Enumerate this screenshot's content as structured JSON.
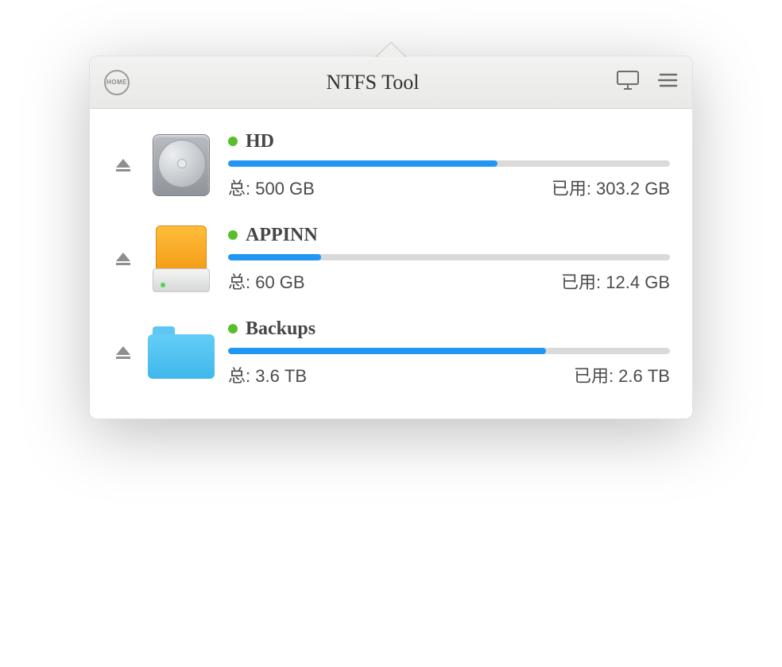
{
  "header": {
    "home_label": "HOME",
    "title": "NTFS Tool"
  },
  "labels": {
    "total_prefix": "总: ",
    "used_prefix": "已用: "
  },
  "drives": [
    {
      "name": "HD",
      "total": "500 GB",
      "used": "303.2 GB",
      "percent": 61,
      "icon": "hdd"
    },
    {
      "name": "APPINN",
      "total": "60 GB",
      "used": "12.4 GB",
      "percent": 21,
      "icon": "external"
    },
    {
      "name": "Backups",
      "total": "3.6 TB",
      "used": "2.6 TB",
      "percent": 72,
      "icon": "folder"
    }
  ]
}
